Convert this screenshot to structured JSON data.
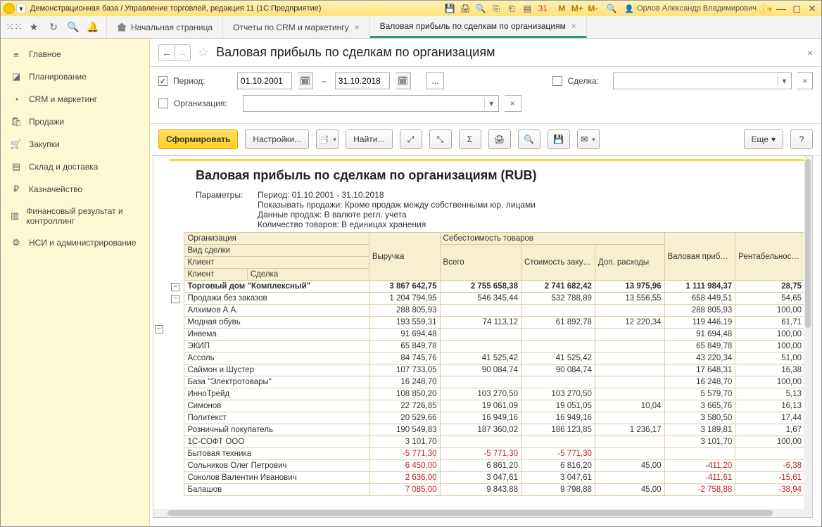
{
  "titlebar": {
    "app_title": "Демонстрационная база / Управление торговлей, редакция 11 (1С:Предприятие)",
    "user_name": "Орлов Александр Владимирович",
    "memory": {
      "m": "M",
      "mplus": "M+",
      "mminus": "M-"
    }
  },
  "tabs": {
    "home": "Начальная страница",
    "reports": "Отчеты по CRM и маркетингу",
    "current": "Валовая прибыль по сделкам по организациям"
  },
  "sidebar": [
    {
      "icon": "≡",
      "label": "Главное"
    },
    {
      "icon": "◪",
      "label": "Планирование"
    },
    {
      "icon": "◔",
      "label": "CRM и маркетинг"
    },
    {
      "icon": "🛍",
      "label": "Продажи"
    },
    {
      "icon": "🛒",
      "label": "Закупки"
    },
    {
      "icon": "▤",
      "label": "Склад и доставка"
    },
    {
      "icon": "₽",
      "label": "Казначейство"
    },
    {
      "icon": "▥",
      "label": "Финансовый результат и контроллинг"
    },
    {
      "icon": "⚙",
      "label": "НСИ и администрирование"
    }
  ],
  "content_header": {
    "title": "Валовая прибыль по сделкам по организациям"
  },
  "filters": {
    "period_label": "Период:",
    "date_from": "01.10.2001",
    "date_to": "31.10.2018",
    "dash": "–",
    "dots": "...",
    "deal_label": "Сделка:",
    "org_label": "Организация:"
  },
  "toolbar": {
    "run": "Сформировать",
    "settings": "Настройки...",
    "find": "Найти...",
    "more": "Еще"
  },
  "report": {
    "title": "Валовая прибыль по сделкам по организациям (RUB)",
    "params_label": "Параметры:",
    "params": [
      "Период: 01.10.2001 - 31.10.2018",
      "Показывать продажи: Кроме продаж между собственными юр. лицами",
      "Данные продаж: В валюте регл. учета",
      "Количество товаров: В единицах хранения"
    ],
    "headers": {
      "org": "Организация",
      "deal_type": "Вид сделки",
      "client": "Клиент",
      "client2": "Клиент",
      "deal": "Сделка",
      "revenue": "Выручка",
      "cost": "Себестоимость товаров",
      "cost_total": "Всего",
      "cost_purch": "Стоимость закупки",
      "cost_extra": "Доп. расходы",
      "gross": "Валовая прибыль",
      "margin": "Рентабельность, %"
    },
    "rows": [
      {
        "lvl": 0,
        "name": "Торговый дом \"Комплексный\"",
        "rev": "3 867 642,75",
        "ct": "2 755 658,38",
        "cp": "2 741 682,42",
        "ce": "13 975,96",
        "gp": "1 111 984,37",
        "m": "28,75"
      },
      {
        "lvl": 1,
        "name": "Продажи без заказов",
        "rev": "1 204 794,95",
        "ct": "546 345,44",
        "cp": "532 788,89",
        "ce": "13 556,55",
        "gp": "658 449,51",
        "m": "54,65"
      },
      {
        "lvl": 2,
        "name": "Алхимов А.А.",
        "rev": "288 805,93",
        "ct": "",
        "cp": "",
        "ce": "",
        "gp": "288 805,93",
        "m": "100,00"
      },
      {
        "lvl": 2,
        "name": "Модная обувь",
        "rev": "193 559,31",
        "ct": "74 113,12",
        "cp": "61 892,78",
        "ce": "12 220,34",
        "gp": "119 446,19",
        "m": "61,71"
      },
      {
        "lvl": 2,
        "name": "Инвема",
        "rev": "91 694,48",
        "ct": "",
        "cp": "",
        "ce": "",
        "gp": "91 694,48",
        "m": "100,00"
      },
      {
        "lvl": 2,
        "name": "ЭКИП",
        "rev": "65 849,78",
        "ct": "",
        "cp": "",
        "ce": "",
        "gp": "65 849,78",
        "m": "100,00"
      },
      {
        "lvl": 2,
        "name": "Ассоль",
        "rev": "84 745,76",
        "ct": "41 525,42",
        "cp": "41 525,42",
        "ce": "",
        "gp": "43 220,34",
        "m": "51,00"
      },
      {
        "lvl": 2,
        "name": "Саймон и Шустер",
        "rev": "107 733,05",
        "ct": "90 084,74",
        "cp": "90 084,74",
        "ce": "",
        "gp": "17 648,31",
        "m": "16,38"
      },
      {
        "lvl": 2,
        "name": "База \"Электротовары\"",
        "rev": "16 248,70",
        "ct": "",
        "cp": "",
        "ce": "",
        "gp": "16 248,70",
        "m": "100,00"
      },
      {
        "lvl": 2,
        "name": "ИнноТрейд",
        "rev": "108 850,20",
        "ct": "103 270,50",
        "cp": "103 270,50",
        "ce": "",
        "gp": "5 579,70",
        "m": "5,13"
      },
      {
        "lvl": 2,
        "name": "Симонов",
        "rev": "22 726,85",
        "ct": "19 061,09",
        "cp": "19 051,05",
        "ce": "10,04",
        "gp": "3 665,76",
        "m": "16,13"
      },
      {
        "lvl": 2,
        "name": "Политекст",
        "rev": "20 529,66",
        "ct": "16 949,16",
        "cp": "16 949,16",
        "ce": "",
        "gp": "3 580,50",
        "m": "17,44"
      },
      {
        "lvl": 2,
        "name": "Розничный покупатель",
        "rev": "190 549,83",
        "ct": "187 360,02",
        "cp": "186 123,85",
        "ce": "1 236,17",
        "gp": "3 189,81",
        "m": "1,67"
      },
      {
        "lvl": 2,
        "name": "1С-СОФТ ООО",
        "rev": "3 101,70",
        "ct": "",
        "cp": "",
        "ce": "",
        "gp": "3 101,70",
        "m": "100,00"
      },
      {
        "lvl": 2,
        "name": "Бытовая техника",
        "rev": "-5 771,30",
        "ct": "-5 771,30",
        "cp": "-5 771,30",
        "ce": "",
        "gp": "",
        "m": "",
        "neg": true
      },
      {
        "lvl": 2,
        "name": "Сольников Олег Петрович",
        "rev": "6 450,00",
        "ct": "6 861,20",
        "cp": "6 816,20",
        "ce": "45,00",
        "gp": "-411,20",
        "m": "-6,38",
        "neg": true
      },
      {
        "lvl": 2,
        "name": "Соколов Валентин Иванович",
        "rev": "2 636,00",
        "ct": "3 047,61",
        "cp": "3 047,61",
        "ce": "",
        "gp": "-411,61",
        "m": "-15,61",
        "neg": true
      },
      {
        "lvl": 2,
        "name": "Балашов",
        "rev": "7 085,00",
        "ct": "9 843,88",
        "cp": "9 798,88",
        "ce": "45,00",
        "gp": "-2 758,88",
        "m": "-38,94",
        "neg": true
      }
    ]
  }
}
